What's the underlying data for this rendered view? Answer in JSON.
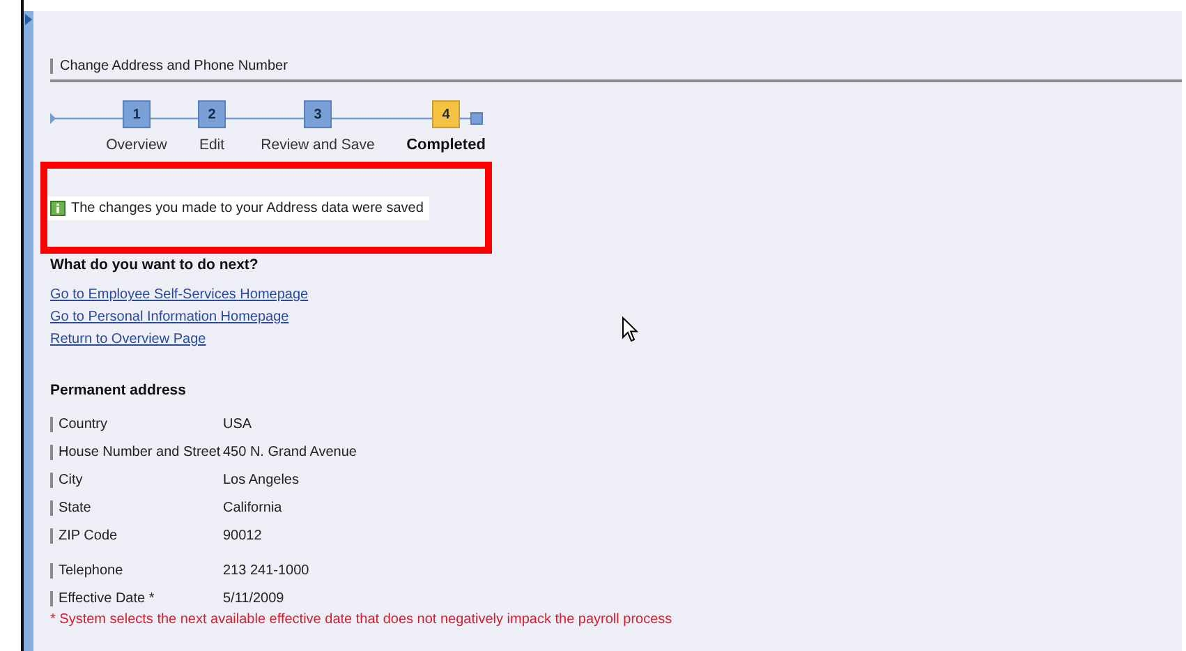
{
  "page_title": "Change Address and Phone Number",
  "steps": [
    {
      "number": "1",
      "label": "Overview",
      "selected": false
    },
    {
      "number": "2",
      "label": "Edit",
      "selected": false
    },
    {
      "number": "3",
      "label": "Review and Save",
      "selected": false
    },
    {
      "number": "4",
      "label": "Completed",
      "selected": true
    }
  ],
  "message": {
    "text": "The changes you made to your Address data were saved",
    "highlighted": true
  },
  "next_heading": "What do you want to do next?",
  "links": [
    "Go to Employee Self-Services Homepage",
    "Go to Personal Information Homepage",
    "Return to Overview Page"
  ],
  "section_title": "Permanent address",
  "address_fields": [
    {
      "label": "Country",
      "value": "USA"
    },
    {
      "label": "House Number and Street",
      "value": "450 N. Grand Avenue"
    },
    {
      "label": "City",
      "value": "Los Angeles"
    },
    {
      "label": "State",
      "value": "California"
    },
    {
      "label": "ZIP Code",
      "value": "90012"
    }
  ],
  "contact_fields": [
    {
      "label": "Telephone",
      "value": "213 241-1000"
    },
    {
      "label": "Effective Date *",
      "value": "5/11/2009"
    }
  ],
  "footnote": "* System selects the next available effective date that does not negatively impack the payroll process"
}
